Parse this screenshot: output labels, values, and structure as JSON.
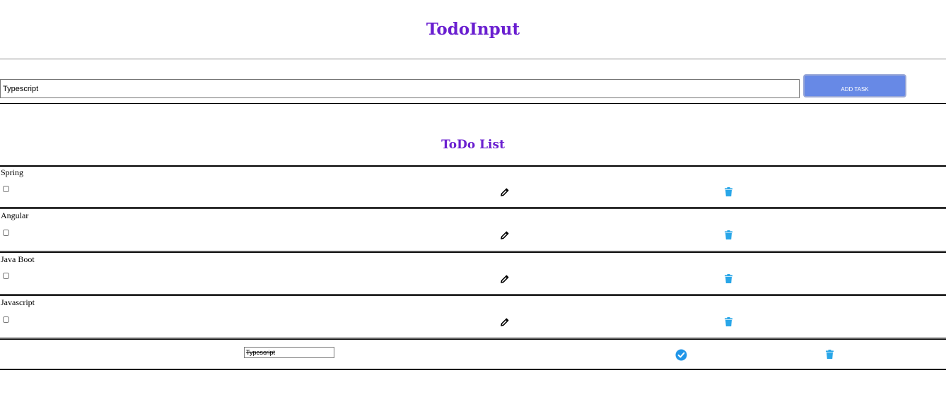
{
  "header": {
    "title": "TodoInput"
  },
  "input": {
    "value": "Typescript",
    "add_button_label": "ADD TASK"
  },
  "list": {
    "title": "ToDo List",
    "items": [
      {
        "label": "Spring",
        "checked": false,
        "edit_icon": "pencil-icon",
        "delete_icon": "trash-icon"
      },
      {
        "label": "Angular",
        "checked": false,
        "edit_icon": "pencil-icon",
        "delete_icon": "trash-icon"
      },
      {
        "label": "Java Boot",
        "checked": false,
        "edit_icon": "pencil-icon",
        "delete_icon": "trash-icon"
      },
      {
        "label": "Javascript",
        "checked": false,
        "edit_icon": "pencil-icon",
        "delete_icon": "trash-icon"
      }
    ],
    "editing_item": {
      "value": "Typescript",
      "save_icon": "check-circle-icon",
      "delete_icon": "trash-icon"
    }
  },
  "colors": {
    "heading": "#6a1fd0",
    "button": "#6789e6",
    "trash": "#29a6e8",
    "check": "#2196e8"
  }
}
